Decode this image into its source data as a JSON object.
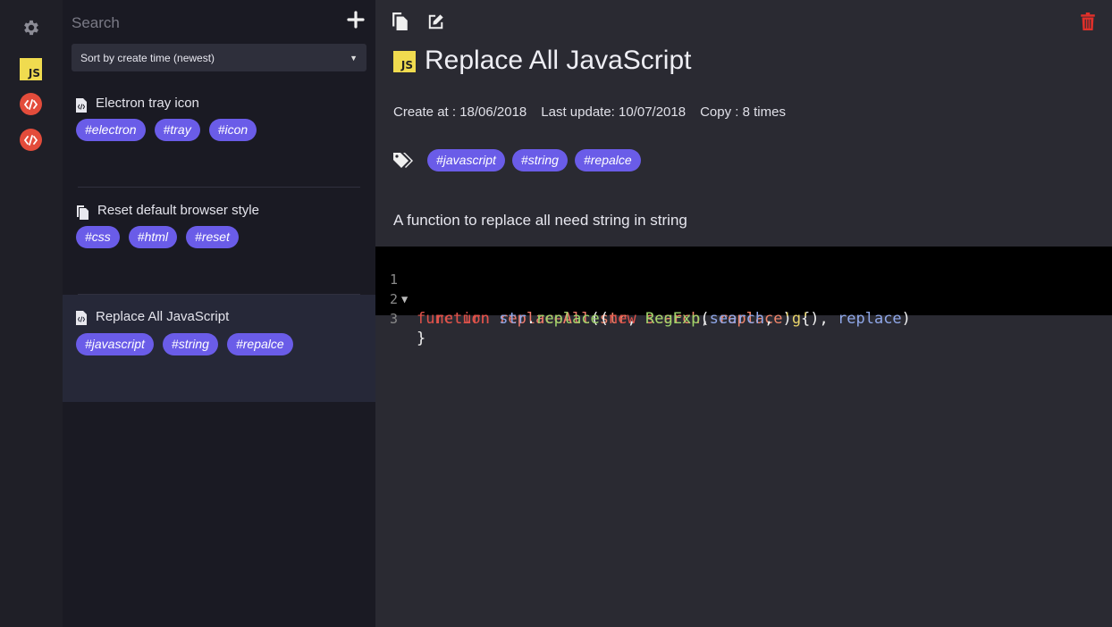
{
  "sidebar": {
    "icons": [
      {
        "name": "settings",
        "icon": "gear-icon"
      },
      {
        "name": "javascript",
        "icon": "js-icon",
        "label": "JS"
      },
      {
        "name": "code-1",
        "icon": "code-icon"
      },
      {
        "name": "code-2",
        "icon": "code-icon"
      }
    ]
  },
  "list": {
    "search_placeholder": "Search",
    "sort_label": "Sort by create time (newest)",
    "items": [
      {
        "title": "Electron tray icon",
        "icon": "code-file-icon",
        "tags": [
          "#electron",
          "#tray",
          "#icon"
        ]
      },
      {
        "title": "Reset default browser style",
        "icon": "copy-files-icon",
        "tags": [
          "#css",
          "#html",
          "#reset"
        ]
      },
      {
        "title": "Replace All JavaScript",
        "icon": "code-file-icon",
        "tags": [
          "#javascript",
          "#string",
          "#repalce"
        ],
        "active": true
      }
    ]
  },
  "detail": {
    "lang_badge": "JS",
    "title": "Replace All JavaScript",
    "created": "Create at : 18/06/2018",
    "updated": "Last update: 10/07/2018",
    "copies": "Copy : 8 times",
    "tags": [
      "#javascript",
      "#string",
      "#repalce"
    ],
    "description": "A function to replace all need string in string",
    "code_lines": [
      "function replaceAll(str, search, replace) {",
      "  return str.replace(new RegExp(search, 'g'), replace)",
      "}"
    ],
    "line_numbers": [
      "1",
      "2",
      "3"
    ]
  },
  "colors": {
    "accent_tag": "#6a5ce8",
    "js_yellow": "#f0db4f",
    "code_red": "#e34c3b",
    "trash_red": "#e0302a"
  }
}
